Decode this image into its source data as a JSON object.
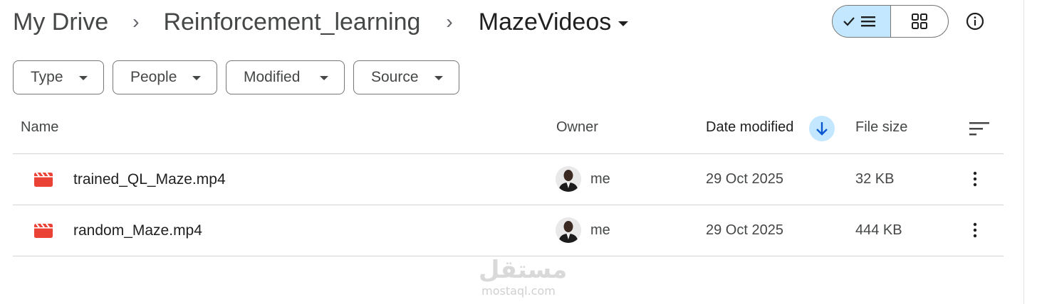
{
  "breadcrumb": {
    "items": [
      "My Drive",
      "Reinforcement_learning",
      "MazeVideos"
    ],
    "separator": "›"
  },
  "toolbar": {
    "list_view": "list-view-icon",
    "grid_view": "grid-view-icon",
    "info": "info-icon"
  },
  "filters": [
    {
      "label": "Type"
    },
    {
      "label": "People"
    },
    {
      "label": "Modified"
    },
    {
      "label": "Source"
    }
  ],
  "table": {
    "columns": {
      "name": "Name",
      "owner": "Owner",
      "date_modified": "Date modified",
      "file_size": "File size"
    },
    "sort": {
      "column": "Date modified",
      "direction": "descending"
    },
    "rows": [
      {
        "name": "trained_QL_Maze.mp4",
        "owner": "me",
        "date": "29 Oct 2025",
        "size": "32 KB",
        "icon": "video-file-icon"
      },
      {
        "name": "random_Maze.mp4",
        "owner": "me",
        "date": "29 Oct 2025",
        "size": "444 KB",
        "icon": "video-file-icon"
      }
    ]
  },
  "watermark": {
    "arabic": "مستقل",
    "latin": "mostaql.com"
  },
  "colors": {
    "accent": "#c2e7ff",
    "sort_arrow": "#0b57d0",
    "video_icon": "#ea4335",
    "text_primary": "#1f1f1f",
    "text_secondary": "#444746"
  }
}
